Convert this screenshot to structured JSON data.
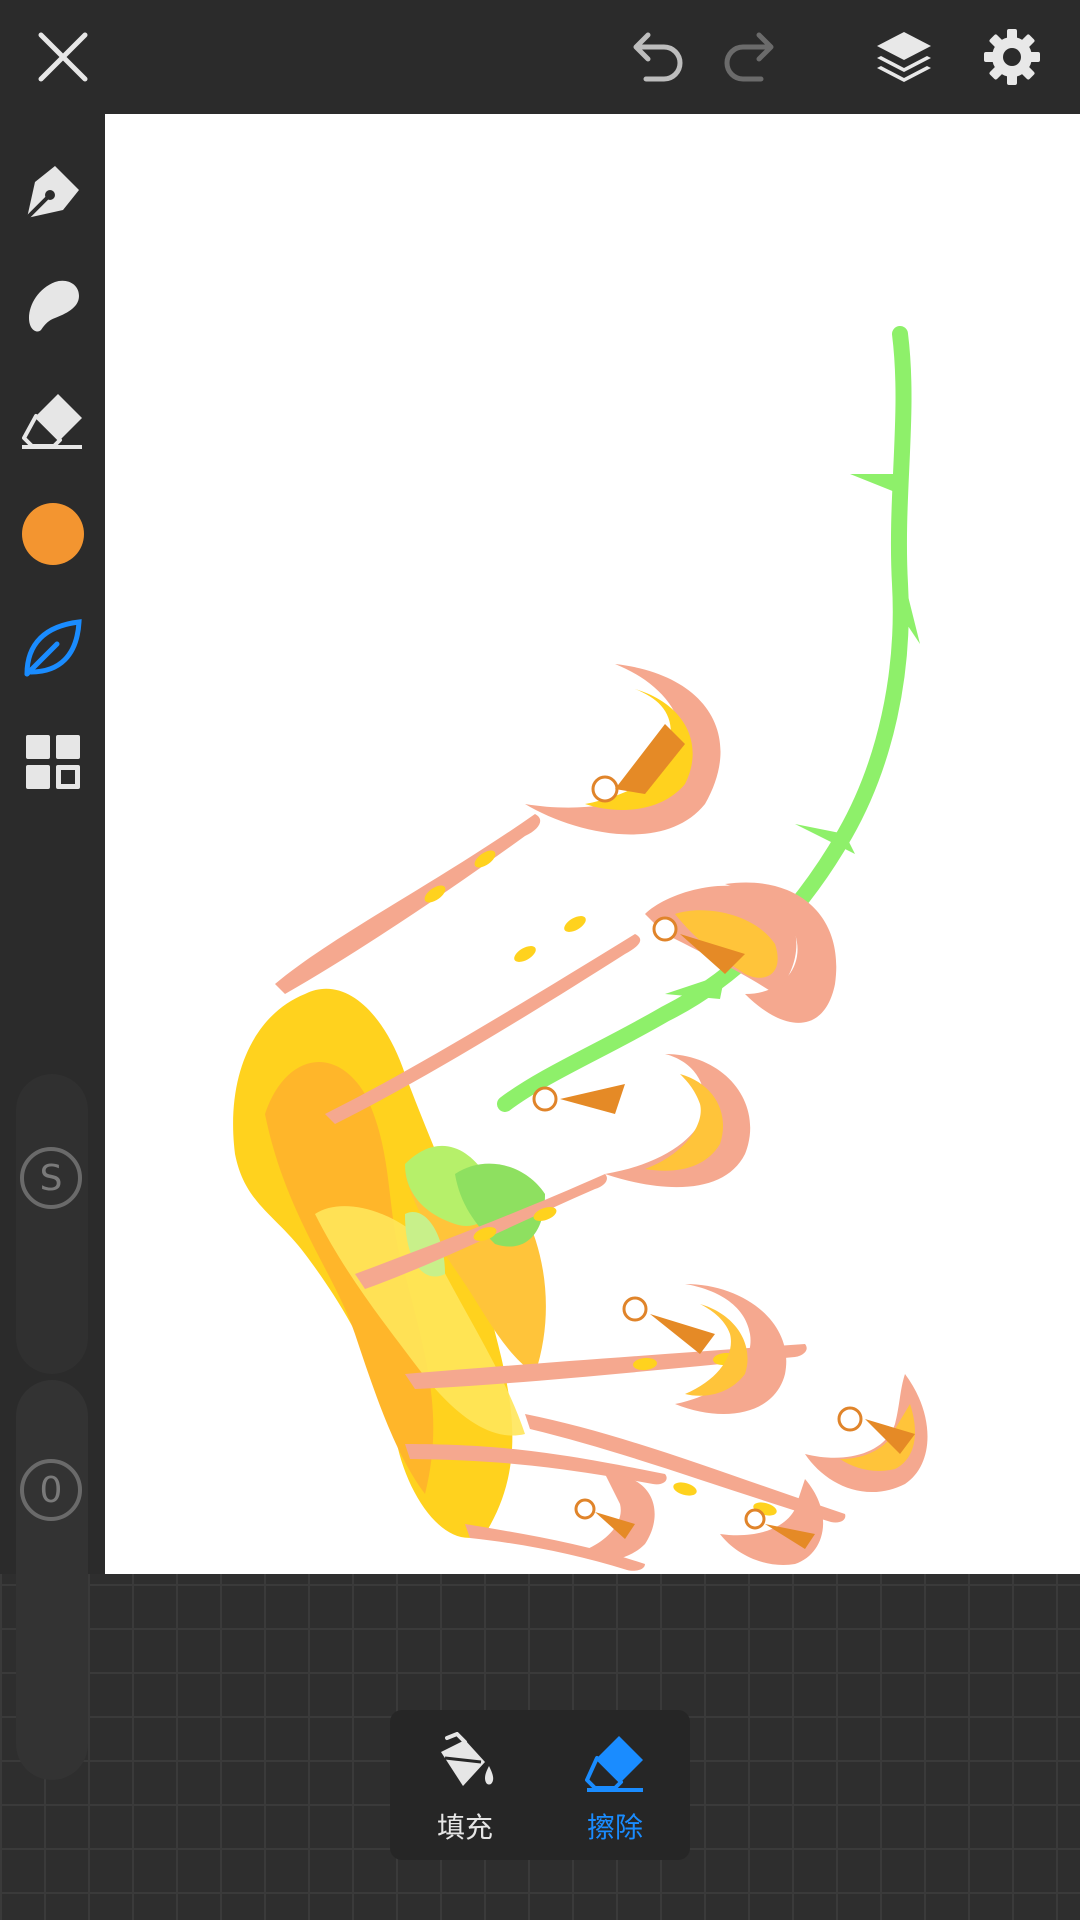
{
  "app": {
    "accent_color": "#1a8cff",
    "brush_color": "#f39530"
  },
  "topbar": {
    "close_icon": "close-icon",
    "undo_icon": "undo-icon",
    "redo_icon": "redo-icon",
    "layers_icon": "layers-icon",
    "settings_icon": "gear-icon"
  },
  "sidebar": {
    "tools": [
      {
        "name": "pen-tool",
        "icon": "pen-nib-icon"
      },
      {
        "name": "smudge-tool",
        "icon": "smudge-icon"
      },
      {
        "name": "eraser-tool",
        "icon": "eraser-icon"
      },
      {
        "name": "color-picker",
        "icon": "color-swatch"
      },
      {
        "name": "brush-tool",
        "icon": "leaf-icon",
        "active": true
      },
      {
        "name": "grid-tool",
        "icon": "grid-icon"
      }
    ],
    "size_slider_label": "S",
    "opacity_slider_label": "0"
  },
  "bottom_panel": {
    "fill_label": "填充",
    "erase_label": "擦除",
    "active": "erase"
  }
}
